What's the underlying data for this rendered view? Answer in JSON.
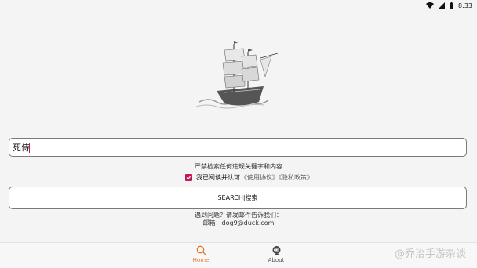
{
  "status_bar": {
    "time": "8:33",
    "icons": [
      "wifi-icon",
      "signal-icon",
      "battery-icon"
    ]
  },
  "search": {
    "value": "死侍",
    "placeholder": ""
  },
  "notice": "严禁检索任何违规关键字和内容",
  "agreement": {
    "checked": true,
    "text": "我已阅读并认可",
    "links": "《使用协议》《隐私政策》"
  },
  "search_button": "SEARCH|搜索",
  "contact": {
    "line1": "遇到问题？请发邮件告诉我们：",
    "line2": "邮箱：dog9@duck.com"
  },
  "bottom_nav": {
    "items": [
      {
        "label": "Home",
        "icon": "search-icon",
        "active": true
      },
      {
        "label": "About",
        "icon": "robot-icon",
        "active": false
      }
    ]
  },
  "watermark": "@乔治手游杂谈",
  "colors": {
    "accent": "#c2185b",
    "nav_active": "#e07a2e",
    "background": "#f4f4f4"
  }
}
